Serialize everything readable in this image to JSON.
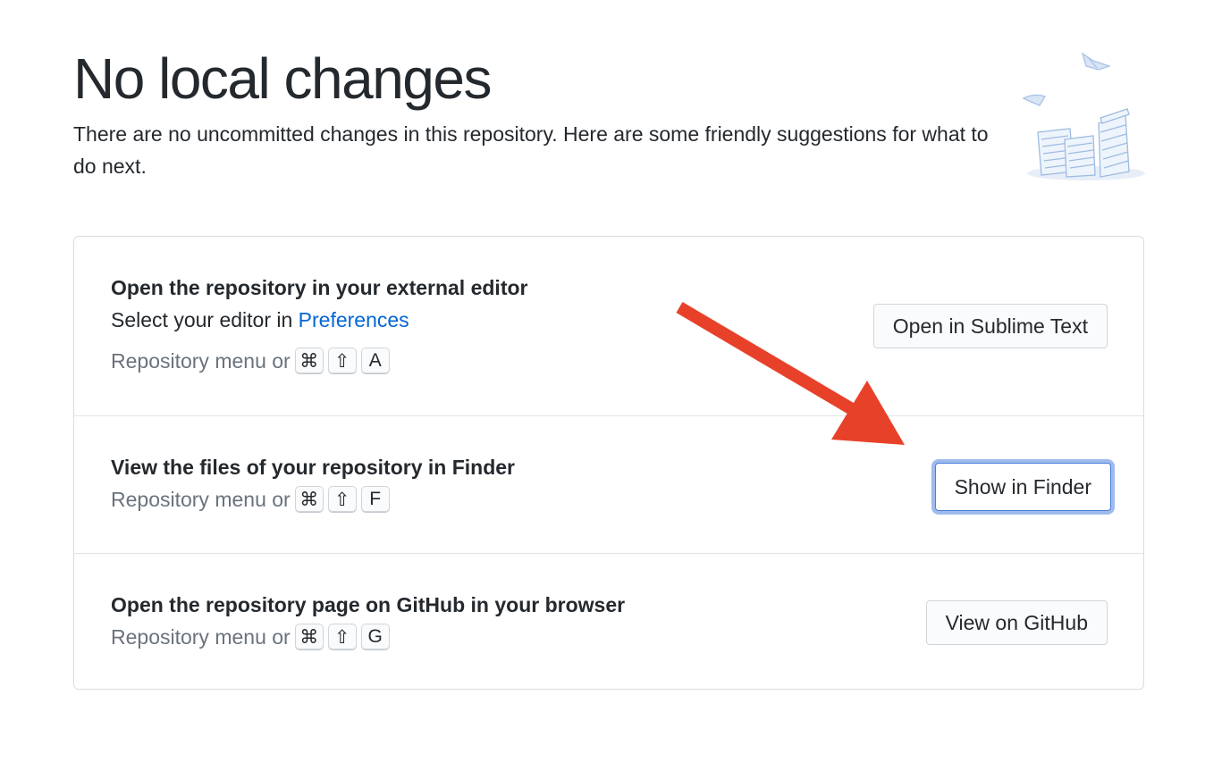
{
  "header": {
    "title": "No local changes",
    "description": "There are no uncommitted changes in this repository. Here are some friendly suggestions for what to do next."
  },
  "suggestions": [
    {
      "title": "Open the repository in your external editor",
      "subtitle_prefix": "Select your editor in ",
      "subtitle_link": "Preferences",
      "shortcut_prefix": "Repository menu or",
      "keys": [
        "⌘",
        "⇧",
        "A"
      ],
      "button": "Open in Sublime Text"
    },
    {
      "title": "View the files of your repository in Finder",
      "shortcut_prefix": "Repository menu or",
      "keys": [
        "⌘",
        "⇧",
        "F"
      ],
      "button": "Show in Finder",
      "focused": true
    },
    {
      "title": "Open the repository page on GitHub in your browser",
      "shortcut_prefix": "Repository menu or",
      "keys": [
        "⌘",
        "⇧",
        "G"
      ],
      "button": "View on GitHub"
    }
  ],
  "colors": {
    "link": "#0366d6",
    "focus_ring": "#9fbbee",
    "annotation_arrow": "#e8412a"
  },
  "icons": {
    "illustration": "paper-stacks-illustration-icon",
    "annotation": "red-arrow-icon"
  }
}
